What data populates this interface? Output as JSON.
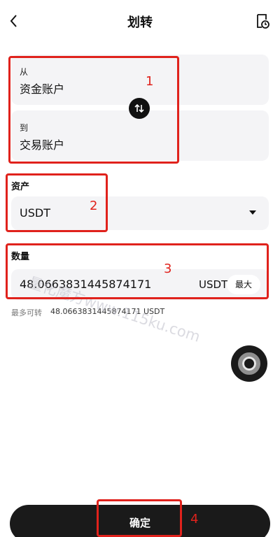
{
  "header": {
    "title": "划转",
    "back_icon": "chevron-left-icon",
    "history_icon": "history-clock-icon"
  },
  "transfer": {
    "from_label": "从",
    "from_account": "资金账户",
    "to_label": "到",
    "to_account": "交易账户",
    "swap_icon": "swap-arrows-icon"
  },
  "asset": {
    "label": "资产",
    "value": "USDT",
    "caret_icon": "caret-down-icon"
  },
  "amount": {
    "label": "数量",
    "value": "48.0663831445874171",
    "unit": "USDT",
    "max_label": "最大"
  },
  "available": {
    "label": "最多可转",
    "value": "48.0663831445874171 USDT"
  },
  "confirm_label": "确定",
  "annotations": [
    "1",
    "2",
    "3",
    "4"
  ],
  "watermark": "量化魔方www.115ku.com",
  "colors": {
    "annotation": "#e0221c",
    "card_bg": "#f4f4f6",
    "button_bg": "#1a1a1a"
  }
}
